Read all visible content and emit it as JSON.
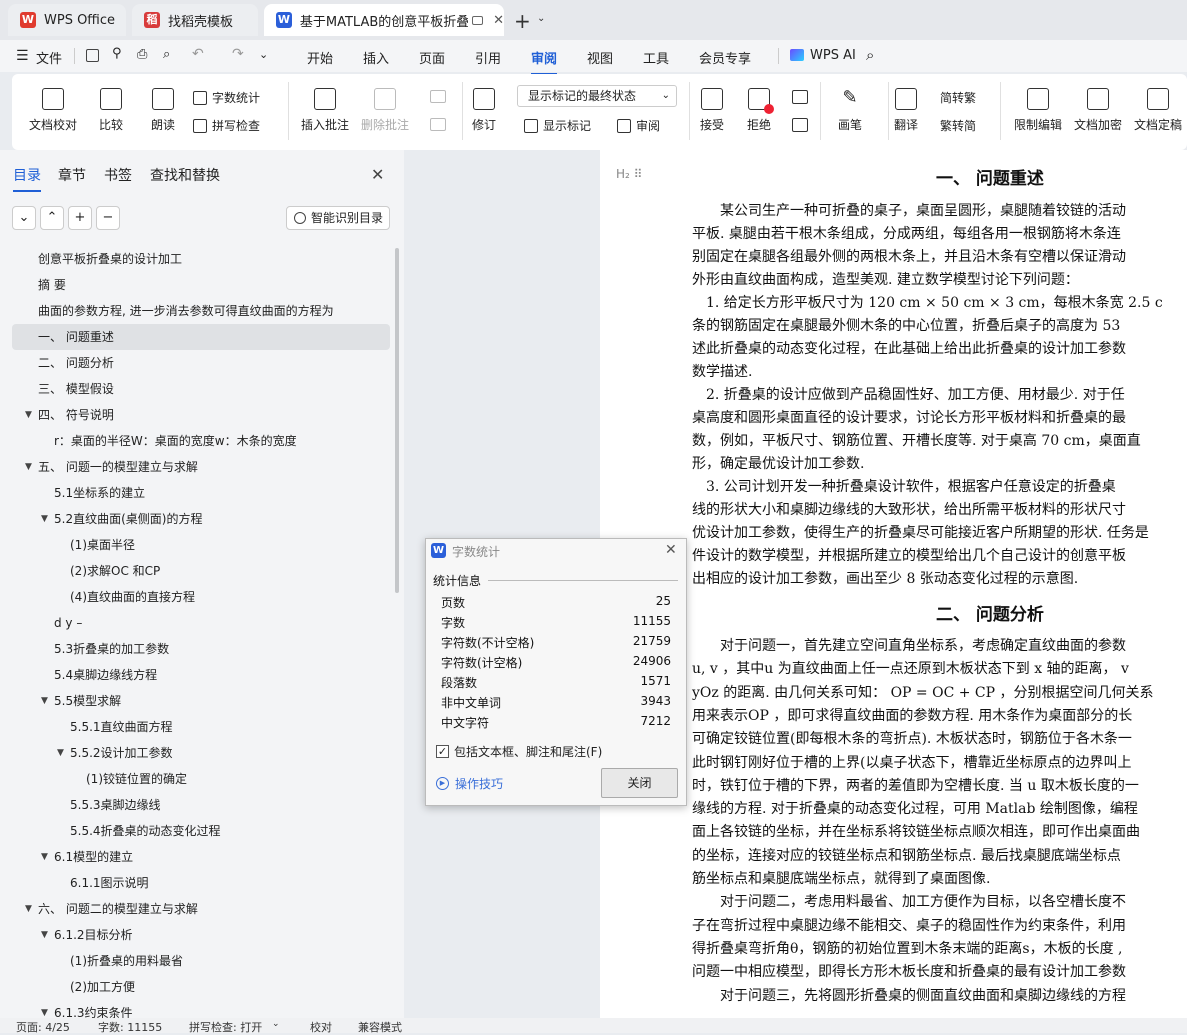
{
  "tabs": [
    {
      "label": "WPS Office",
      "icon": "wps-logo-icon",
      "color": "#e03b2f"
    },
    {
      "label": "找稻壳模板",
      "icon": "docer-icon",
      "color": "#d83b3b"
    },
    {
      "label": "基于MATLAB的创意平板折叠",
      "icon": "word-doc-icon",
      "color": "#2b5fd9"
    }
  ],
  "menu": {
    "file": "文件",
    "items": [
      "开始",
      "插入",
      "页面",
      "引用",
      "审阅",
      "视图",
      "工具",
      "会员专享"
    ],
    "active": "审阅",
    "ai": "WPS AI"
  },
  "ribbon": {
    "doc_check": "文档校对",
    "compare": "比较",
    "read_aloud": "朗读",
    "word_count": "字数统计",
    "spell_check": "拼写检查",
    "insert_comment": "插入批注",
    "delete_comment": "删除批注",
    "revise": "修订",
    "markup_state": "显示标记的最终状态",
    "show_markup": "显示标记",
    "review": "审阅",
    "accept": "接受",
    "reject": "拒绝",
    "pen": "画笔",
    "translate": "翻译",
    "trad_simp": "简转繁",
    "simp_trad": "繁转简",
    "restrict_edit": "限制编辑",
    "encrypt": "文档加密",
    "finalize": "文档定稿"
  },
  "sidebar": {
    "tabs": [
      "目录",
      "章节",
      "书签",
      "查找和替换"
    ],
    "smart_toc": "智能识别目录",
    "toc": [
      {
        "text": "创意平板折叠桌的设计加工",
        "indent": 0,
        "arrow": ""
      },
      {
        "text": "摘 要",
        "indent": 0,
        "arrow": ""
      },
      {
        "text": "曲面的参数方程, 进一步消去参数可得直纹曲面的方程为",
        "indent": 0,
        "arrow": ""
      },
      {
        "text": "一、 问题重述",
        "indent": 0,
        "arrow": "",
        "sel": true
      },
      {
        "text": "二、 问题分析",
        "indent": 0,
        "arrow": ""
      },
      {
        "text": "三、 模型假设",
        "indent": 0,
        "arrow": ""
      },
      {
        "text": "四、 符号说明",
        "indent": 0,
        "arrow": "▼"
      },
      {
        "text": "r：桌面的半径W：桌面的宽度w：木条的宽度",
        "indent": 1,
        "arrow": ""
      },
      {
        "text": "五、 问题一的模型建立与求解",
        "indent": 0,
        "arrow": "▼"
      },
      {
        "text": "5.1坐标系的建立",
        "indent": 1,
        "arrow": ""
      },
      {
        "text": "5.2直纹曲面(桌侧面)的方程",
        "indent": 1,
        "arrow": "▼"
      },
      {
        "text": "(1)桌面半径",
        "indent": 2,
        "arrow": ""
      },
      {
        "text": "(2)求解OC 和CP",
        "indent": 2,
        "arrow": ""
      },
      {
        "text": "(4)直纹曲面的直接方程",
        "indent": 2,
        "arrow": ""
      },
      {
        "text": "d y –",
        "indent": 1,
        "arrow": ""
      },
      {
        "text": "5.3折叠桌的加工参数",
        "indent": 1,
        "arrow": ""
      },
      {
        "text": "5.4桌脚边缘线方程",
        "indent": 1,
        "arrow": ""
      },
      {
        "text": "5.5模型求解",
        "indent": 1,
        "arrow": "▼"
      },
      {
        "text": "5.5.1直纹曲面方程",
        "indent": 2,
        "arrow": ""
      },
      {
        "text": "5.5.2设计加工参数",
        "indent": 2,
        "arrow": "▼"
      },
      {
        "text": "(1)铰链位置的确定",
        "indent": 3,
        "arrow": ""
      },
      {
        "text": "5.5.3桌脚边缘线",
        "indent": 2,
        "arrow": ""
      },
      {
        "text": "5.5.4折叠桌的动态变化过程",
        "indent": 2,
        "arrow": ""
      },
      {
        "text": "6.1模型的建立",
        "indent": 1,
        "arrow": "▼"
      },
      {
        "text": "6.1.1图示说明",
        "indent": 2,
        "arrow": ""
      },
      {
        "text": "六、 问题二的模型建立与求解",
        "indent": 0,
        "arrow": "▼"
      },
      {
        "text": "6.1.2目标分析",
        "indent": 1,
        "arrow": "▼"
      },
      {
        "text": "(1)折叠桌的用料最省",
        "indent": 2,
        "arrow": ""
      },
      {
        "text": "(2)加工方便",
        "indent": 2,
        "arrow": ""
      },
      {
        "text": "6.1.3约束条件",
        "indent": 1,
        "arrow": "▼"
      }
    ]
  },
  "doc": {
    "heading1": "一、  问题重述",
    "heading2": "二、  问题分析",
    "lines1": [
      "　　某公司生产一种可折叠的桌子，桌面呈圆形，桌腿随着铰链的活动",
      "平板. 桌腿由若干根木条组成，分成两组，每组各用一根钢筋将木条连",
      "别固定在桌腿各组最外侧的两根木条上，并且沿木条有空槽以保证滑动",
      "外形由直纹曲面构成，造型美观. 建立数学模型讨论下列问题：",
      "　1. 给定长方形平板尺寸为  120 cm × 50 cm × 3 cm，每根木条宽  2.5 c",
      "条的钢筋固定在桌腿最外侧木条的中心位置，折叠后桌子的高度为  53 ",
      "述此折叠桌的动态变化过程，在此基础上给出此折叠桌的设计加工参数",
      "数学描述.",
      "　2. 折叠桌的设计应做到产品稳固性好、加工方便、用材最少. 对于任",
      "桌高度和圆形桌面直径的设计要求，讨论长方形平板材料和折叠桌的最",
      "数，例如，平板尺寸、钢筋位置、开槽长度等. 对于桌高 70 cm，桌面直",
      "形，确定最优设计加工参数.",
      "　3. 公司计划开发一种折叠桌设计软件，根据客户任意设定的折叠桌",
      "线的形状大小和桌脚边缘线的大致形状，给出所需平板材料的形状尺寸",
      "优设计加工参数，使得生产的折叠桌尽可能接近客户所期望的形状. 任务是",
      "件设计的数学模型，并根据所建立的模型给出几个自己设计的创意平板",
      "出相应的设计加工参数，画出至少  8 张动态变化过程的示意图."
    ],
    "lines2": [
      "　　对于问题一，首先建立空间直角坐标系，考虑确定直纹曲面的参数",
      "u, v ，其中u 为直纹曲面上任一点还原到木板状态下到  x 轴的距离，  v",
      "yOz 的距离. 由几何关系可知：  OP = OC + CP  ，分别根据空间几何关系",
      "用来表示OP ，即可求得直纹曲面的参数方程. 用木条作为桌面部分的长",
      "可确定铰链位置(即每根木条的弯折点). 木板状态时，钢筋位于各木条一",
      "此时钢钉刚好位于槽的上界(以桌子状态下，槽靠近坐标原点的边界叫上",
      "时，铁钉位于槽的下界，两者的差值即为空槽长度. 当 u 取木板长度的一",
      "缘线的方程. 对于折叠桌的动态变化过程，可用  Matlab 绘制图像，编程",
      "面上各铰链的坐标，并在坐标系将铰链坐标点顺次相连，即可作出桌面曲",
      "的坐标，连接对应的铰链坐标点和钢筋坐标点. 最后找桌腿底端坐标点",
      "筋坐标点和桌腿底端坐标点，就得到了桌面图像.",
      "　　对于问题二，考虑用料最省、加工方便作为目标，以各空槽长度不",
      "子在弯折过程中桌腿边缘不能相交、桌子的稳固性作为约束条件，利用",
      "得折叠桌弯折角θ，钢筋的初始位置到木条末端的距离s，木板的长度 ,",
      "问题一中相应模型，即得长方形木板长度和折叠桌的最有设计加工参数",
      "　　对于问题三，先将圆形折叠桌的侧面直纹曲面和桌脚边缘线的方程"
    ]
  },
  "dialog": {
    "title": "字数统计",
    "section": "统计信息",
    "rows": [
      {
        "label": "页数",
        "value": "25"
      },
      {
        "label": "字数",
        "value": "11155"
      },
      {
        "label": "字符数(不计空格)",
        "value": "21759"
      },
      {
        "label": "字符数(计空格)",
        "value": "24906"
      },
      {
        "label": "段落数",
        "value": "1571"
      },
      {
        "label": "非中文单词",
        "value": "3943"
      },
      {
        "label": "中文字符",
        "value": "7212"
      }
    ],
    "checkbox": "包括文本框、脚注和尾注(F)",
    "tips": "操作技巧",
    "close": "关闭"
  },
  "status": {
    "page": "页面: 4/25",
    "words": "字数: 11155",
    "spell": "拼写检查: 打开",
    "proof": "校对",
    "compat": "兼容模式"
  }
}
